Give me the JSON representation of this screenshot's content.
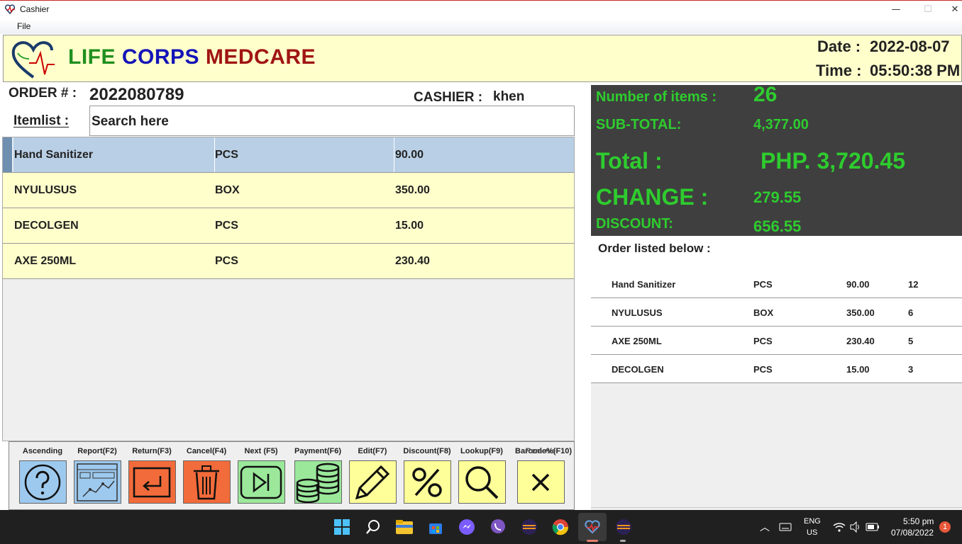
{
  "window": {
    "title": "Cashier",
    "minimize": "—",
    "maximize": "☐",
    "close": "✕"
  },
  "menu": {
    "file": "File"
  },
  "header": {
    "brand_1": "LIFE",
    "brand_2": "CORPS",
    "brand_3": "MEDCARE",
    "date_label": "Date :",
    "date_value": "2022-08-07",
    "time_label": "Time :",
    "time_value": "05:50:38 PM"
  },
  "order": {
    "order_label": "ORDER # :",
    "order_no": "2022080789",
    "cashier_label": "CASHIER :",
    "cashier_name": "khen",
    "itemlist_label": "Itemlist :",
    "search_value": "Search here"
  },
  "items": [
    {
      "name": "Hand Sanitizer",
      "unit": "PCS",
      "price": "90.00"
    },
    {
      "name": "NYULUSUS",
      "unit": "BOX",
      "price": "350.00"
    },
    {
      "name": "DECOLGEN",
      "unit": "PCS",
      "price": "15.00"
    },
    {
      "name": "AXE 250ML",
      "unit": "PCS",
      "price": "230.40"
    }
  ],
  "toolbar": [
    {
      "label": "Ascending",
      "icon": "help-icon",
      "color": "#9ec9ee"
    },
    {
      "label": "Report(F2)",
      "icon": "report-chart-icon",
      "color": "#9ec9ee"
    },
    {
      "label": "Return(F3)",
      "icon": "return-icon",
      "color": "#f26b3a"
    },
    {
      "label": "Cancel(F4)",
      "icon": "trash-icon",
      "color": "#f26b3a"
    },
    {
      "label": "Next (F5)",
      "icon": "next-icon",
      "color": "#9be89b"
    },
    {
      "label": "Payment(F6)",
      "icon": "coins-icon",
      "color": "#9be89b"
    },
    {
      "label": "Edit(F7)",
      "icon": "pencil-icon",
      "color": "#ffff99"
    },
    {
      "label": "Discount(F8)",
      "icon": "percent-icon",
      "color": "#ffff99"
    },
    {
      "label": "Lookup(F9)",
      "icon": "search-icon",
      "color": "#ffff99"
    },
    {
      "label": "Barcode%(F10)",
      "label_overlap": "Remove",
      "icon": "close-icon",
      "color": "#ffff99"
    }
  ],
  "summary": {
    "items_label": "Number of items :",
    "items_value": "26",
    "subtotal_label": "SUB-TOTAL:",
    "subtotal_value": "4,377.00",
    "total_label": "Total :",
    "total_value": "PHP. 3,720.45",
    "change_label": "CHANGE :",
    "change_value": "279.55",
    "discount_label": "DISCOUNT:",
    "discount_value": "656.55"
  },
  "orderlist": {
    "title": "Order listed below :",
    "rows": [
      {
        "name": "Hand Sanitizer",
        "unit": "PCS",
        "price": "90.00",
        "qty": "12"
      },
      {
        "name": "NYULUSUS",
        "unit": "BOX",
        "price": "350.00",
        "qty": "6"
      },
      {
        "name": "AXE 250ML",
        "unit": "PCS",
        "price": "230.40",
        "qty": "5"
      },
      {
        "name": "DECOLGEN",
        "unit": "PCS",
        "price": "15.00",
        "qty": "3"
      }
    ]
  },
  "taskbar": {
    "lang": "ENG",
    "region": "US",
    "clock_time": "5:50 pm",
    "clock_date": "07/08/2022",
    "notif_count": "1"
  }
}
